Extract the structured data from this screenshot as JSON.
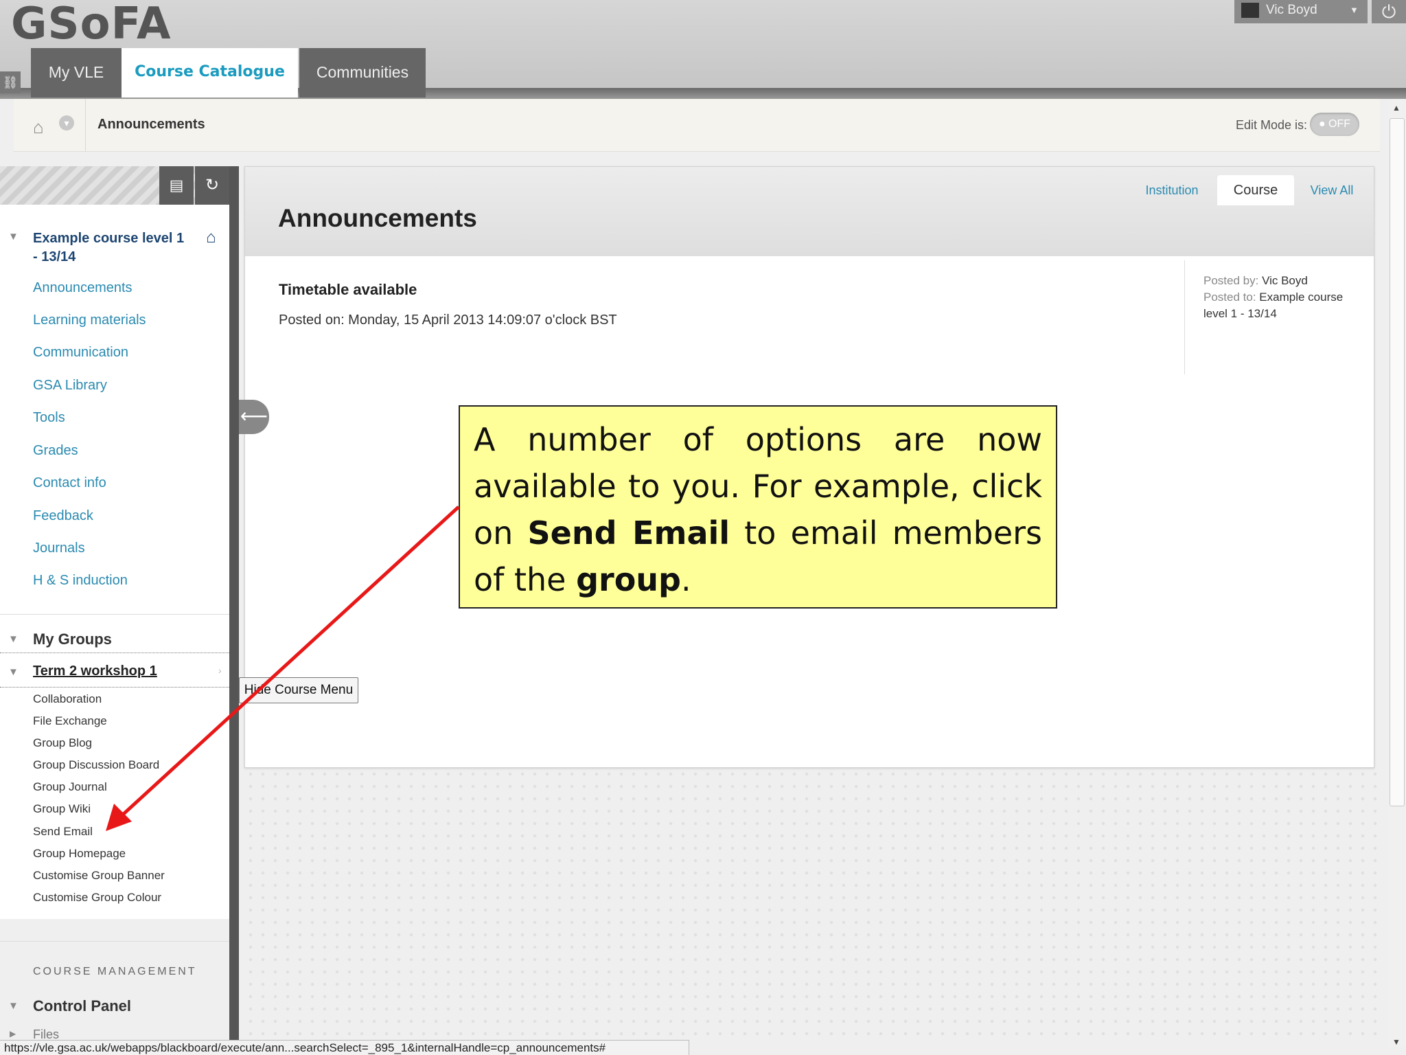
{
  "header": {
    "logo": "GSoFA",
    "link_icon": "link-icon",
    "tabs": [
      {
        "label": "My VLE"
      },
      {
        "label": "Course Catalogue"
      },
      {
        "label": "Communities"
      }
    ],
    "user_name": "Vic Boyd",
    "power_icon": "power-icon"
  },
  "breadcrumb": {
    "title": "Announcements",
    "edit_mode_label": "Edit Mode is:",
    "edit_mode_state": "OFF"
  },
  "menu": {
    "course_title": "Example course level 1 - 13/14",
    "items": [
      {
        "label": "Announcements"
      },
      {
        "label": "Learning materials"
      },
      {
        "label": "Communication"
      },
      {
        "label": "GSA Library"
      },
      {
        "label": "Tools"
      },
      {
        "label": "Grades"
      },
      {
        "label": "Contact info"
      },
      {
        "label": "Feedback"
      },
      {
        "label": "Journals"
      },
      {
        "label": "H & S induction"
      }
    ],
    "my_groups_label": "My Groups",
    "group_name": "Term 2 workshop 1",
    "group_items": [
      {
        "label": "Collaboration"
      },
      {
        "label": "File Exchange"
      },
      {
        "label": "Group Blog"
      },
      {
        "label": "Group Discussion Board"
      },
      {
        "label": "Group Journal"
      },
      {
        "label": "Group Wiki"
      },
      {
        "label": "Send Email"
      },
      {
        "label": "Group Homepage"
      },
      {
        "label": "Customise Group Banner"
      },
      {
        "label": "Customise Group Colour"
      }
    ],
    "course_management_label": "COURSE MANAGEMENT",
    "control_panel_label": "Control Panel",
    "files_label": "Files"
  },
  "tooltip": "Hide Course Menu",
  "content": {
    "page_title": "Announcements",
    "filter_tabs": [
      {
        "label": "Institution"
      },
      {
        "label": "Course"
      },
      {
        "label": "View All"
      }
    ],
    "announcement": {
      "title": "Timetable available",
      "posted_on": "Posted on: Monday, 15 April 2013 14:09:07 o'clock BST",
      "posted_by_label": "Posted by:",
      "posted_by": "Vic Boyd",
      "posted_to_label": "Posted to:",
      "posted_to": "Example course level 1 - 13/14"
    }
  },
  "callout": {
    "part1": "A number of options are now available to you. For example, click on ",
    "bold1": "Send Email",
    "part2": " to email members of the ",
    "bold2": "group",
    "part3": "."
  },
  "status_url": "https://vle.gsa.ac.uk/webapps/blackboard/execute/ann...searchSelect=_895_1&internalHandle=cp_announcements#",
  "colors": {
    "accent": "#2a8ab0",
    "course_title": "#1d4571",
    "callout_bg": "#ffff99",
    "arrow": "#e81818"
  }
}
